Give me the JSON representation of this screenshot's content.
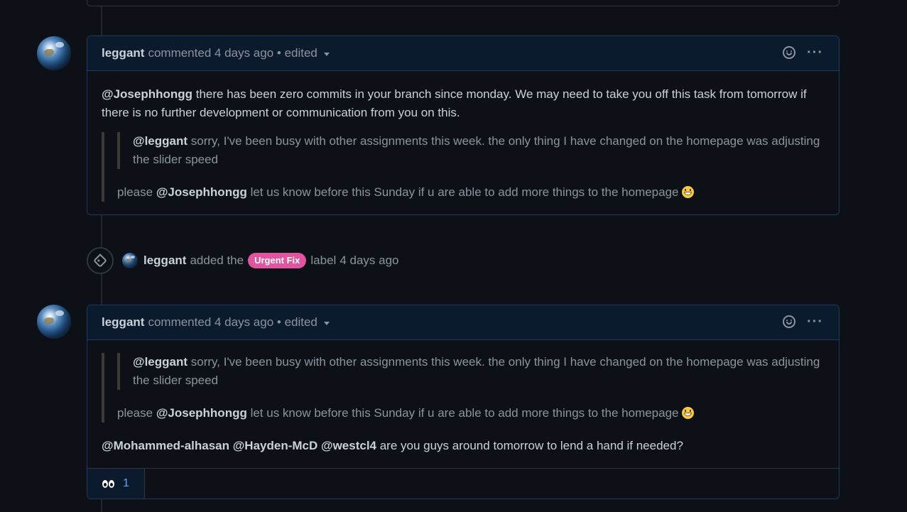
{
  "comments": [
    {
      "author": "leggant",
      "meta": "commented 4 days ago • edited",
      "body_mention": "@Josephhongg",
      "body_text": " there has been zero commits in your branch since monday. We may need to take you off this task from tomorrow if there is no further development or communication from you on this.",
      "nested_mention": "@leggant",
      "nested_text": " sorry, I've been busy with other assignments this week. the only thing I have changed on the homepage was adjusting the slider speed",
      "quote_prefix": "please ",
      "quote_mention": "@Josephhongg",
      "quote_text": " let us know before this Sunday if u are able to add more things to the homepage"
    },
    {
      "author": "leggant",
      "meta": "commented 4 days ago • edited",
      "nested_mention": "@leggant",
      "nested_text": " sorry, I've been busy with other assignments this week. the only thing I have changed on the homepage was adjusting the slider speed",
      "quote_prefix": "please ",
      "quote_mention": "@Josephhongg",
      "quote_text": " let us know before this Sunday if u are able to add more things to the homepage",
      "mentions": "@Mohammed-alhasan @Hayden-McD @westcl4",
      "mentions_text": " are you guys around tomorrow to lend a hand if needed?",
      "reaction_count": "1"
    }
  ],
  "event": {
    "author": "leggant",
    "pre": "added the",
    "label": "Urgent Fix",
    "post": "label",
    "time": "4 days ago"
  },
  "icons": {
    "add_reaction": "smiley-icon",
    "more": "kebab-icon",
    "label_event": "tag-icon",
    "reaction": "eyes-icon"
  },
  "colors": {
    "label": "#e0559f",
    "background": "#0d1117",
    "header": "#0c1a2e"
  }
}
